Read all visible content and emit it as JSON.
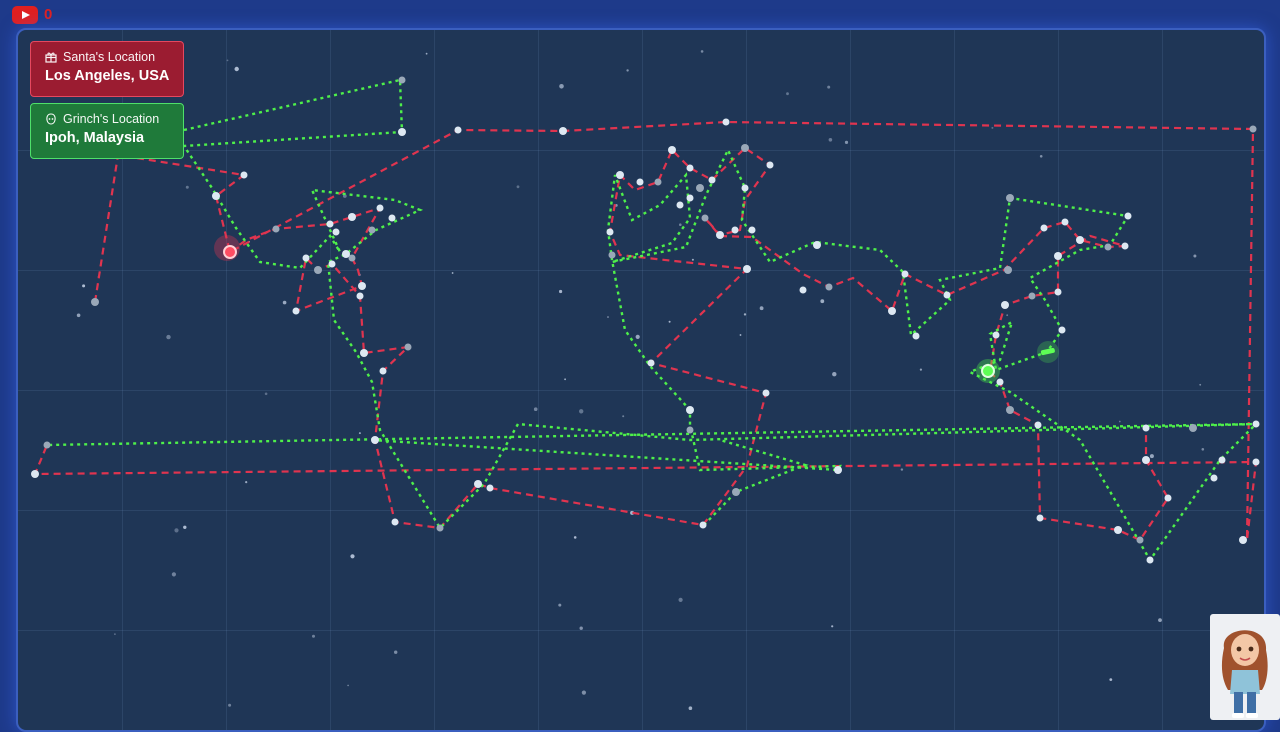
{
  "top_bar": {
    "icon": "youtube-icon",
    "notification_count": "0"
  },
  "santa": {
    "label": "Santa's Location",
    "location": "Los Angeles, USA",
    "icon": "gift-icon",
    "color": "#9b1c31"
  },
  "grinch": {
    "label": "Grinch's Location",
    "location": "Ipoh, Malaysia",
    "icon": "grinch-icon",
    "color": "#1f7a3a"
  },
  "map": {
    "santa_route_color": "#e0344f",
    "grinch_route_color": "#4ef04a",
    "background": "#1f3656"
  },
  "avatar": {
    "icon": "girl-avatar-image"
  }
}
